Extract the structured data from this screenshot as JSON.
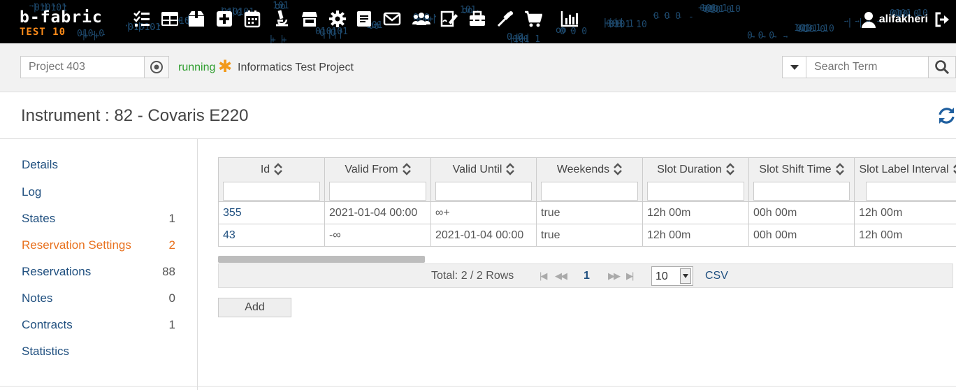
{
  "header": {
    "logo_name": "b-fabric",
    "logo_env": "TEST 10",
    "username": "alifakheri",
    "bg_tokens": [
      "- - - -",
      "· · · ·",
      "| |",
      "010101",
      "· · ·",
      "0 0",
      "||||",
      "+++",
      "101 1",
      "0101 10",
      "010 0",
      "- - -",
      "| |",
      "+ +",
      "101",
      "oo",
      "· ·",
      "0 0 0"
    ],
    "nav_icons": [
      "tasks-icon",
      "table-icon",
      "box-icon",
      "plus-square-icon",
      "calendar-icon",
      "microscope-icon",
      "store-icon",
      "gear-icon",
      "form-icon",
      "envelope-icon",
      "users-icon",
      "signature-icon",
      "toolbox-icon",
      "pipette-icon",
      "cart-icon",
      "chart-icon"
    ]
  },
  "project": {
    "placeholder": "Project 403",
    "status": "running",
    "star": "✱",
    "name": "Informatics Test Project"
  },
  "search": {
    "placeholder": "Search Term"
  },
  "page": {
    "title": "Instrument : 82 - Covaris E220"
  },
  "sidebar": {
    "items": [
      {
        "label": "Details",
        "count": ""
      },
      {
        "label": "Log",
        "count": ""
      },
      {
        "label": "States",
        "count": "1"
      },
      {
        "label": "Reservation Settings",
        "count": "2"
      },
      {
        "label": "Reservations",
        "count": "88"
      },
      {
        "label": "Notes",
        "count": "0"
      },
      {
        "label": "Contracts",
        "count": "1"
      },
      {
        "label": "Statistics",
        "count": ""
      }
    ],
    "active_index": 3
  },
  "table": {
    "columns": [
      "Id",
      "Valid From",
      "Valid Until",
      "Weekends",
      "Slot Duration",
      "Slot Shift Time",
      "Slot Label Interval"
    ],
    "rows": [
      [
        "355",
        "2021-01-04 00:00",
        "∞+",
        "true",
        "12h 00m",
        "00h 00m",
        "12h 00m"
      ],
      [
        "43",
        "-∞",
        "2021-01-04 00:00",
        "true",
        "12h 00m",
        "00h 00m",
        "12h 00m"
      ]
    ]
  },
  "pager": {
    "total": "Total: 2 / 2 Rows",
    "first": "|◀",
    "prev": "◀◀",
    "page": "1",
    "next": "▶▶",
    "last": "▶|",
    "page_size": "10",
    "csv": "CSV"
  },
  "actions": {
    "add_label": "Add"
  },
  "colors": {
    "topbar": "#000000",
    "accent_orange": "#e8711e",
    "link_blue": "#1f4f7f",
    "status_green": "#2e9e2e"
  }
}
